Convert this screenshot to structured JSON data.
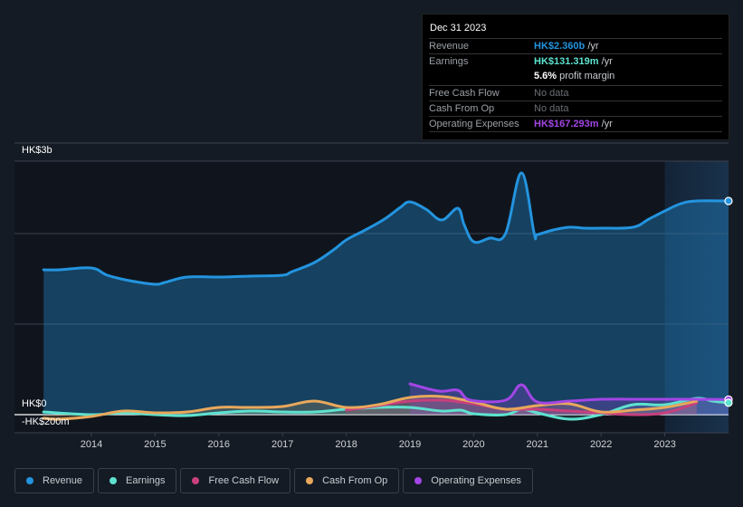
{
  "tooltip": {
    "date": "Dec 31 2023",
    "rows": [
      {
        "label": "Revenue",
        "value": "HK$2.360b",
        "unit": " /yr",
        "color": "#2394df"
      },
      {
        "label": "Earnings",
        "value": "HK$131.319m",
        "unit": " /yr",
        "color": "#5ee2cf"
      },
      {
        "label": "",
        "value": "5.6%",
        "unit": " profit margin",
        "color": "#ffffff"
      },
      {
        "label": "Free Cash Flow",
        "value": "No data",
        "unit": "",
        "color": ""
      },
      {
        "label": "Cash From Op",
        "value": "No data",
        "unit": "",
        "color": ""
      },
      {
        "label": "Operating Expenses",
        "value": "HK$167.293m",
        "unit": " /yr",
        "color": "#a346e6"
      }
    ]
  },
  "legend": [
    {
      "label": "Revenue",
      "color": "#2394df"
    },
    {
      "label": "Earnings",
      "color": "#5ee2cf"
    },
    {
      "label": "Free Cash Flow",
      "color": "#c8407e"
    },
    {
      "label": "Cash From Op",
      "color": "#e8a85c"
    },
    {
      "label": "Operating Expenses",
      "color": "#a346e6"
    }
  ],
  "chart_data": {
    "type": "area",
    "title": "",
    "xlabel": "",
    "ylabel": "",
    "y_unit": "HK$ millions",
    "xlim": [
      2013.0,
      2024.0
    ],
    "ylim": [
      -200,
      3000
    ],
    "y_tick_labels": [
      "HK$3b",
      "HK$0",
      "-HK$200m"
    ],
    "x_tick_labels": [
      "2014",
      "2015",
      "2016",
      "2017",
      "2018",
      "2019",
      "2020",
      "2021",
      "2022",
      "2023"
    ],
    "x_ticks": [
      2014,
      2015,
      2016,
      2017,
      2018,
      2019,
      2020,
      2021,
      2022,
      2023
    ],
    "highlight_from": 2023.0,
    "series": [
      {
        "name": "Revenue",
        "color": "#2394df",
        "x": [
          2013.25,
          2013.5,
          2014.0,
          2014.25,
          2014.6,
          2015.0,
          2015.15,
          2015.5,
          2016.0,
          2016.5,
          2017.0,
          2017.15,
          2017.5,
          2017.8,
          2018.0,
          2018.3,
          2018.6,
          2018.85,
          2019.0,
          2019.25,
          2019.5,
          2019.75,
          2019.85,
          2020.0,
          2020.25,
          2020.5,
          2020.75,
          2020.95,
          2021.0,
          2021.25,
          2021.5,
          2021.75,
          2022.0,
          2022.5,
          2022.75,
          2023.0,
          2023.25,
          2023.5,
          2024.0
        ],
        "values": [
          1600,
          1600,
          1620,
          1540,
          1480,
          1440,
          1460,
          1520,
          1520,
          1530,
          1540,
          1580,
          1680,
          1820,
          1930,
          2040,
          2160,
          2290,
          2350,
          2270,
          2150,
          2280,
          2100,
          1910,
          1950,
          2000,
          2670,
          2000,
          1990,
          2040,
          2070,
          2060,
          2060,
          2070,
          2160,
          2250,
          2330,
          2360,
          2360
        ]
      },
      {
        "name": "Earnings",
        "color": "#5ee2cf",
        "x": [
          2013.25,
          2014.0,
          2014.5,
          2015.0,
          2015.5,
          2016.0,
          2016.5,
          2017.0,
          2017.5,
          2018.0,
          2018.5,
          2019.0,
          2019.5,
          2019.8,
          2020.0,
          2020.5,
          2020.75,
          2021.0,
          2021.5,
          2022.0,
          2022.5,
          2023.0,
          2023.5,
          2023.75,
          2024.0
        ],
        "values": [
          30,
          0,
          20,
          0,
          -10,
          20,
          40,
          30,
          30,
          60,
          80,
          80,
          40,
          50,
          10,
          0,
          60,
          20,
          -50,
          0,
          110,
          110,
          180,
          150,
          131
        ]
      },
      {
        "name": "Free Cash Flow",
        "color": "#c8407e",
        "x": [
          2018.0,
          2018.5,
          2019.0,
          2019.5,
          2020.0,
          2020.5,
          2021.0,
          2021.5,
          2022.0,
          2022.5,
          2023.0,
          2023.5
        ],
        "values": [
          50,
          100,
          150,
          160,
          120,
          60,
          60,
          40,
          20,
          0,
          20,
          130
        ]
      },
      {
        "name": "Cash From Op",
        "color": "#e8a85c",
        "x": [
          2013.25,
          2013.5,
          2014.0,
          2014.5,
          2015.0,
          2015.5,
          2016.0,
          2016.5,
          2017.0,
          2017.5,
          2018.0,
          2018.5,
          2019.0,
          2019.5,
          2020.0,
          2020.5,
          2021.0,
          2021.5,
          2022.0,
          2022.5,
          2023.0,
          2023.5
        ],
        "values": [
          -40,
          -50,
          -20,
          40,
          20,
          30,
          80,
          80,
          90,
          150,
          80,
          110,
          190,
          200,
          140,
          60,
          100,
          120,
          30,
          50,
          80,
          150
        ]
      },
      {
        "name": "Operating Expenses",
        "color": "#a346e6",
        "x": [
          2019.0,
          2019.45,
          2019.75,
          2019.95,
          2020.5,
          2020.75,
          2021.0,
          2021.5,
          2022.0,
          2022.5,
          2023.0,
          2023.5,
          2024.0
        ],
        "values": [
          340,
          260,
          270,
          160,
          160,
          330,
          140,
          150,
          170,
          170,
          170,
          170,
          167
        ]
      }
    ]
  }
}
